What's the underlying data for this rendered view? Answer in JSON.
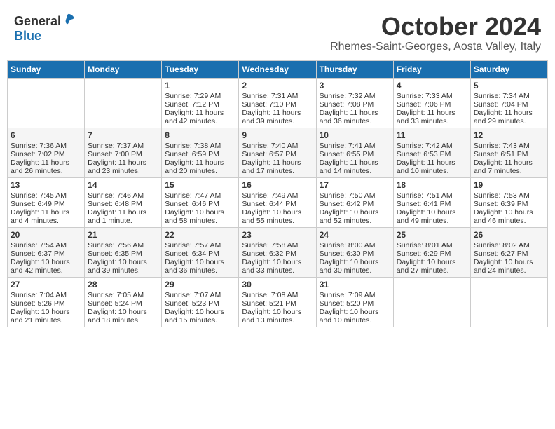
{
  "header": {
    "logo_general": "General",
    "logo_blue": "Blue",
    "month_title": "October 2024",
    "location": "Rhemes-Saint-Georges, Aosta Valley, Italy"
  },
  "days_of_week": [
    "Sunday",
    "Monday",
    "Tuesday",
    "Wednesday",
    "Thursday",
    "Friday",
    "Saturday"
  ],
  "weeks": [
    [
      {
        "day": "",
        "sunrise": "",
        "sunset": "",
        "daylight": ""
      },
      {
        "day": "",
        "sunrise": "",
        "sunset": "",
        "daylight": ""
      },
      {
        "day": "1",
        "sunrise": "Sunrise: 7:29 AM",
        "sunset": "Sunset: 7:12 PM",
        "daylight": "Daylight: 11 hours and 42 minutes."
      },
      {
        "day": "2",
        "sunrise": "Sunrise: 7:31 AM",
        "sunset": "Sunset: 7:10 PM",
        "daylight": "Daylight: 11 hours and 39 minutes."
      },
      {
        "day": "3",
        "sunrise": "Sunrise: 7:32 AM",
        "sunset": "Sunset: 7:08 PM",
        "daylight": "Daylight: 11 hours and 36 minutes."
      },
      {
        "day": "4",
        "sunrise": "Sunrise: 7:33 AM",
        "sunset": "Sunset: 7:06 PM",
        "daylight": "Daylight: 11 hours and 33 minutes."
      },
      {
        "day": "5",
        "sunrise": "Sunrise: 7:34 AM",
        "sunset": "Sunset: 7:04 PM",
        "daylight": "Daylight: 11 hours and 29 minutes."
      }
    ],
    [
      {
        "day": "6",
        "sunrise": "Sunrise: 7:36 AM",
        "sunset": "Sunset: 7:02 PM",
        "daylight": "Daylight: 11 hours and 26 minutes."
      },
      {
        "day": "7",
        "sunrise": "Sunrise: 7:37 AM",
        "sunset": "Sunset: 7:00 PM",
        "daylight": "Daylight: 11 hours and 23 minutes."
      },
      {
        "day": "8",
        "sunrise": "Sunrise: 7:38 AM",
        "sunset": "Sunset: 6:59 PM",
        "daylight": "Daylight: 11 hours and 20 minutes."
      },
      {
        "day": "9",
        "sunrise": "Sunrise: 7:40 AM",
        "sunset": "Sunset: 6:57 PM",
        "daylight": "Daylight: 11 hours and 17 minutes."
      },
      {
        "day": "10",
        "sunrise": "Sunrise: 7:41 AM",
        "sunset": "Sunset: 6:55 PM",
        "daylight": "Daylight: 11 hours and 14 minutes."
      },
      {
        "day": "11",
        "sunrise": "Sunrise: 7:42 AM",
        "sunset": "Sunset: 6:53 PM",
        "daylight": "Daylight: 11 hours and 10 minutes."
      },
      {
        "day": "12",
        "sunrise": "Sunrise: 7:43 AM",
        "sunset": "Sunset: 6:51 PM",
        "daylight": "Daylight: 11 hours and 7 minutes."
      }
    ],
    [
      {
        "day": "13",
        "sunrise": "Sunrise: 7:45 AM",
        "sunset": "Sunset: 6:49 PM",
        "daylight": "Daylight: 11 hours and 4 minutes."
      },
      {
        "day": "14",
        "sunrise": "Sunrise: 7:46 AM",
        "sunset": "Sunset: 6:48 PM",
        "daylight": "Daylight: 11 hours and 1 minute."
      },
      {
        "day": "15",
        "sunrise": "Sunrise: 7:47 AM",
        "sunset": "Sunset: 6:46 PM",
        "daylight": "Daylight: 10 hours and 58 minutes."
      },
      {
        "day": "16",
        "sunrise": "Sunrise: 7:49 AM",
        "sunset": "Sunset: 6:44 PM",
        "daylight": "Daylight: 10 hours and 55 minutes."
      },
      {
        "day": "17",
        "sunrise": "Sunrise: 7:50 AM",
        "sunset": "Sunset: 6:42 PM",
        "daylight": "Daylight: 10 hours and 52 minutes."
      },
      {
        "day": "18",
        "sunrise": "Sunrise: 7:51 AM",
        "sunset": "Sunset: 6:41 PM",
        "daylight": "Daylight: 10 hours and 49 minutes."
      },
      {
        "day": "19",
        "sunrise": "Sunrise: 7:53 AM",
        "sunset": "Sunset: 6:39 PM",
        "daylight": "Daylight: 10 hours and 46 minutes."
      }
    ],
    [
      {
        "day": "20",
        "sunrise": "Sunrise: 7:54 AM",
        "sunset": "Sunset: 6:37 PM",
        "daylight": "Daylight: 10 hours and 42 minutes."
      },
      {
        "day": "21",
        "sunrise": "Sunrise: 7:56 AM",
        "sunset": "Sunset: 6:35 PM",
        "daylight": "Daylight: 10 hours and 39 minutes."
      },
      {
        "day": "22",
        "sunrise": "Sunrise: 7:57 AM",
        "sunset": "Sunset: 6:34 PM",
        "daylight": "Daylight: 10 hours and 36 minutes."
      },
      {
        "day": "23",
        "sunrise": "Sunrise: 7:58 AM",
        "sunset": "Sunset: 6:32 PM",
        "daylight": "Daylight: 10 hours and 33 minutes."
      },
      {
        "day": "24",
        "sunrise": "Sunrise: 8:00 AM",
        "sunset": "Sunset: 6:30 PM",
        "daylight": "Daylight: 10 hours and 30 minutes."
      },
      {
        "day": "25",
        "sunrise": "Sunrise: 8:01 AM",
        "sunset": "Sunset: 6:29 PM",
        "daylight": "Daylight: 10 hours and 27 minutes."
      },
      {
        "day": "26",
        "sunrise": "Sunrise: 8:02 AM",
        "sunset": "Sunset: 6:27 PM",
        "daylight": "Daylight: 10 hours and 24 minutes."
      }
    ],
    [
      {
        "day": "27",
        "sunrise": "Sunrise: 7:04 AM",
        "sunset": "Sunset: 5:26 PM",
        "daylight": "Daylight: 10 hours and 21 minutes."
      },
      {
        "day": "28",
        "sunrise": "Sunrise: 7:05 AM",
        "sunset": "Sunset: 5:24 PM",
        "daylight": "Daylight: 10 hours and 18 minutes."
      },
      {
        "day": "29",
        "sunrise": "Sunrise: 7:07 AM",
        "sunset": "Sunset: 5:23 PM",
        "daylight": "Daylight: 10 hours and 15 minutes."
      },
      {
        "day": "30",
        "sunrise": "Sunrise: 7:08 AM",
        "sunset": "Sunset: 5:21 PM",
        "daylight": "Daylight: 10 hours and 13 minutes."
      },
      {
        "day": "31",
        "sunrise": "Sunrise: 7:09 AM",
        "sunset": "Sunset: 5:20 PM",
        "daylight": "Daylight: 10 hours and 10 minutes."
      },
      {
        "day": "",
        "sunrise": "",
        "sunset": "",
        "daylight": ""
      },
      {
        "day": "",
        "sunrise": "",
        "sunset": "",
        "daylight": ""
      }
    ]
  ]
}
